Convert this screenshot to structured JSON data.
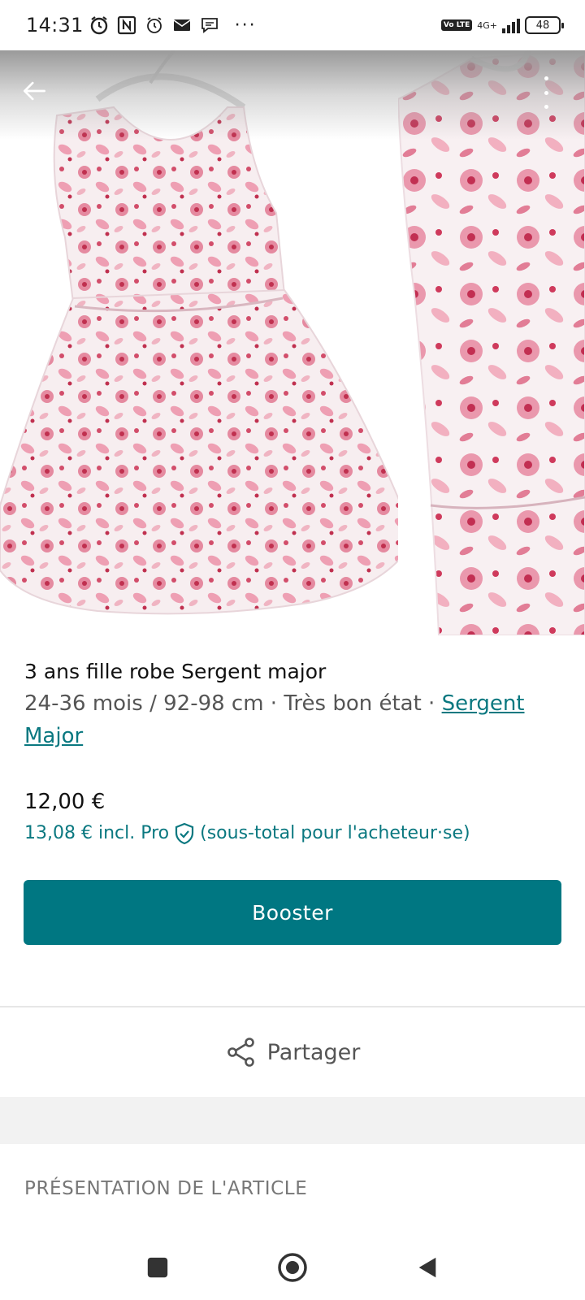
{
  "status_bar": {
    "time": "14:31",
    "left_icons": [
      "alarm-icon",
      "nfc-icon",
      "alarm-icon",
      "mail-icon",
      "chat-icon"
    ],
    "more": "···",
    "volte": "Vo LTE",
    "network": "4G+",
    "battery": "48"
  },
  "gallery": {
    "back_icon": "arrow-left-icon",
    "more_icon": "more-vertical-icon"
  },
  "item": {
    "title": "3 ans fille robe Sergent major",
    "meta": "24-36 mois / 92-98 cm · Très bon état · ",
    "brand": "Sergent Major",
    "price": "12,00 €",
    "price_pro": "13,08 € incl. Pro",
    "price_note": "(sous-total pour l'acheteur·se)"
  },
  "actions": {
    "booster_label": "Booster",
    "share_label": "Partager"
  },
  "sections": {
    "presentation_title": "PRÉSENTATION DE L'ARTICLE"
  },
  "colors": {
    "accent": "#007782",
    "link": "#0a7880"
  }
}
